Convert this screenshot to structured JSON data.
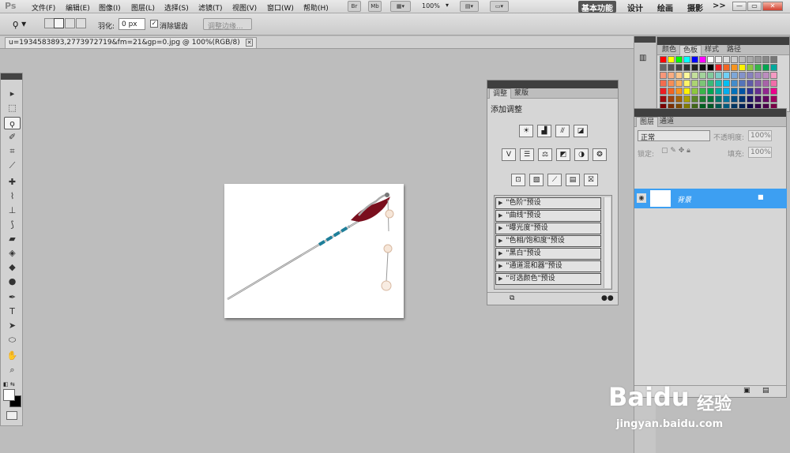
{
  "app": {
    "logo": "Ps"
  },
  "menu": [
    "文件(F)",
    "编辑(E)",
    "图像(I)",
    "图层(L)",
    "选择(S)",
    "滤镜(T)",
    "视图(V)",
    "窗口(W)",
    "帮助(H)"
  ],
  "app_bar": {
    "zoom": "100%",
    "bridge": "Br",
    "minibridge": "Mb"
  },
  "workspaces": [
    "基本功能",
    "设计",
    "绘画",
    "摄影",
    ">>"
  ],
  "window_buttons": [
    "—",
    "▭",
    "✕"
  ],
  "options": {
    "feather_label": "羽化:",
    "feather_value": "0 px",
    "antialias_label": "消除锯齿",
    "antialias_checked": true,
    "refine_edge": "调整边缘..."
  },
  "document": {
    "tab_title": "u=1934583893,2773972719&fm=21&gp=0.jpg @ 100%(RGB/8)",
    "close": "✕"
  },
  "tools": [
    {
      "icon": "move-icon",
      "glyph": "▸"
    },
    {
      "icon": "marquee-icon",
      "glyph": "⬚"
    },
    {
      "icon": "lasso-icon",
      "glyph": "ϙ",
      "selected": true
    },
    {
      "icon": "quick-select-icon",
      "glyph": "✐"
    },
    {
      "icon": "crop-icon",
      "glyph": "⌗"
    },
    {
      "icon": "eyedropper-icon",
      "glyph": "⟋"
    },
    {
      "icon": "healing-icon",
      "glyph": "✚"
    },
    {
      "icon": "brush-icon",
      "glyph": "⌇"
    },
    {
      "icon": "stamp-icon",
      "glyph": "⊥"
    },
    {
      "icon": "history-brush-icon",
      "glyph": "⟆"
    },
    {
      "icon": "eraser-icon",
      "glyph": "▰"
    },
    {
      "icon": "bucket-icon",
      "glyph": "◈"
    },
    {
      "icon": "blur-icon",
      "glyph": "◆"
    },
    {
      "icon": "dodge-icon",
      "glyph": "●"
    },
    {
      "icon": "pen-icon",
      "glyph": "✒"
    },
    {
      "icon": "type-icon",
      "glyph": "T"
    },
    {
      "icon": "path-select-icon",
      "glyph": "➤"
    },
    {
      "icon": "shape-icon",
      "glyph": "⬭"
    },
    {
      "icon": "hand-icon",
      "glyph": "✋"
    },
    {
      "icon": "zoom-icon",
      "glyph": "⌕"
    }
  ],
  "color_panel": {
    "tabs": [
      "颜色",
      "色板",
      "样式",
      "路径"
    ],
    "active": 1
  },
  "swatches": [
    [
      "#ff0000",
      "#ffff00",
      "#00ff00",
      "#00ffff",
      "#0000ff",
      "#ff00ff",
      "#ffffff",
      "#eeeeee",
      "#dddddd",
      "#cccccc",
      "#bbbbbb",
      "#aaaaaa",
      "#999999",
      "#888888",
      "#777777"
    ],
    [
      "#666666",
      "#555555",
      "#444444",
      "#333333",
      "#222222",
      "#111111",
      "#000000",
      "#ee1c24",
      "#f26522",
      "#f7941d",
      "#fff200",
      "#8dc63f",
      "#39b54a",
      "#00a651",
      "#00a99d"
    ],
    [
      "#f7977a",
      "#f9ad81",
      "#fdc68a",
      "#fff79a",
      "#c4df9b",
      "#a3d39c",
      "#82ca9d",
      "#7bcdc8",
      "#6ecff6",
      "#7ea7d8",
      "#8493ca",
      "#8882be",
      "#a187be",
      "#bc8dbf",
      "#f49ac2"
    ],
    [
      "#f26c4f",
      "#f68e56",
      "#fbaf5c",
      "#fff467",
      "#acd372",
      "#7cc576",
      "#3bb878",
      "#1abbb4",
      "#00bff3",
      "#438ccb",
      "#5574b9",
      "#605ca8",
      "#855fa8",
      "#a763a8",
      "#f06ea9"
    ],
    [
      "#ed1c24",
      "#f26522",
      "#f7941d",
      "#fff200",
      "#8dc73f",
      "#39b54a",
      "#00a651",
      "#00a99d",
      "#00aeef",
      "#0072bc",
      "#0054a6",
      "#2e3192",
      "#662d91",
      "#92278f",
      "#ec008c"
    ],
    [
      "#9e0b0f",
      "#a0410d",
      "#a36209",
      "#aba000",
      "#598527",
      "#1a7b30",
      "#007236",
      "#00746b",
      "#0076a3",
      "#004b80",
      "#003471",
      "#1b1464",
      "#440e62",
      "#630460",
      "#9e005d"
    ],
    [
      "#790000",
      "#7b2e00",
      "#7d4900",
      "#827b00",
      "#406618",
      "#005e20",
      "#005826",
      "#005952",
      "#005b7f",
      "#003663",
      "#002157",
      "#0d004c",
      "#32004b",
      "#4b0049",
      "#7b0046"
    ]
  ],
  "adjustments_panel": {
    "tabs": [
      "调整",
      "蒙版"
    ],
    "title": "添加调整",
    "row1": [
      "☀",
      "▟",
      "⫻",
      "◪"
    ],
    "row2": [
      "V",
      "☰",
      "⚖",
      "◩",
      "◑",
      "❂"
    ],
    "row3": [
      "⊡",
      "▧",
      "⟋",
      "▤",
      "⛝"
    ],
    "presets": [
      "\"色阶\"预设",
      "\"曲线\"预设",
      "\"曝光度\"预设",
      "\"色相/饱和度\"预设",
      "\"黑白\"预设",
      "\"通道混和器\"预设",
      "\"可选颜色\"预设"
    ]
  },
  "layers_panel": {
    "tabs": [
      "图层",
      "通道"
    ],
    "blend_mode": "正常",
    "opacity_label": "不透明度:",
    "opacity": "100%",
    "lock_label": "锁定:",
    "fill_label": "填充:",
    "fill": "100%",
    "layer_name": "背景"
  },
  "watermark": {
    "brand": "Baidu",
    "brand_cn": "经验",
    "url": "jingyan.baidu.com"
  }
}
